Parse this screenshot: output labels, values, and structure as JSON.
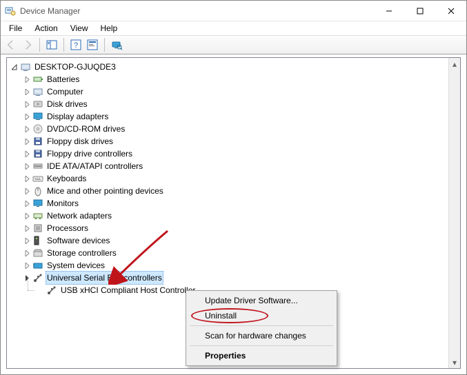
{
  "window": {
    "title": "Device Manager"
  },
  "menubar": {
    "items": [
      "File",
      "Action",
      "View",
      "Help"
    ]
  },
  "tree": {
    "root": "DESKTOP-GJUQDE3",
    "categories": [
      "Batteries",
      "Computer",
      "Disk drives",
      "Display adapters",
      "DVD/CD-ROM drives",
      "Floppy disk drives",
      "Floppy drive controllers",
      "IDE ATA/ATAPI controllers",
      "Keyboards",
      "Mice and other pointing devices",
      "Monitors",
      "Network adapters",
      "Processors",
      "Software devices",
      "Storage controllers",
      "System devices",
      "Universal Serial Bus controllers"
    ],
    "usb_children": [
      "USB xHCI Compliant Host Controller"
    ],
    "selected_index": 16
  },
  "context_menu": {
    "items": [
      "Update Driver Software...",
      "Uninstall",
      "Scan for hardware changes",
      "Properties"
    ],
    "bold_index": 3,
    "separators_after": [
      1,
      2
    ]
  }
}
